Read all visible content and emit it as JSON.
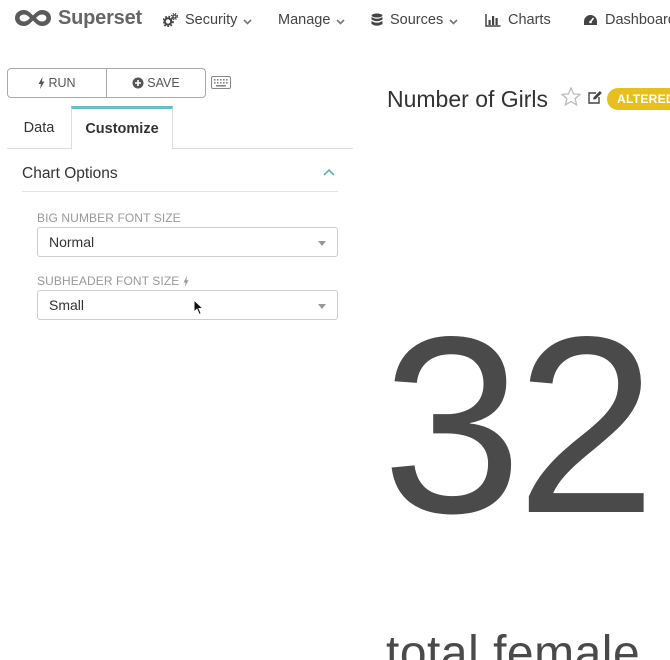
{
  "navbar": {
    "brand": "Superset",
    "items": [
      {
        "label": "Security",
        "icon": "cogs-icon"
      },
      {
        "label": "Manage",
        "icon": ""
      },
      {
        "label": "Sources",
        "icon": "database-icon"
      },
      {
        "label": "Charts",
        "icon": "bar-chart-icon"
      },
      {
        "label": "Dashboards",
        "icon": "dashboard-icon"
      }
    ]
  },
  "toolbar": {
    "run_label": "RUN",
    "save_label": "SAVE"
  },
  "tabs": [
    {
      "label": "Data",
      "active": false
    },
    {
      "label": "Customize",
      "active": true
    }
  ],
  "panel": {
    "title": "Chart Options",
    "fields": [
      {
        "label": "BIG NUMBER FONT SIZE",
        "value": "Normal"
      },
      {
        "label": "SUBHEADER FONT SIZE",
        "value": "Small"
      }
    ]
  },
  "chart": {
    "title": "Number of Girls",
    "status_badge": "ALTERED",
    "big_number": "32",
    "subheader": "total female"
  },
  "colors": {
    "accent": "#6bbdc4",
    "badge": "#e6c01e",
    "number": "#4a4a4a"
  }
}
